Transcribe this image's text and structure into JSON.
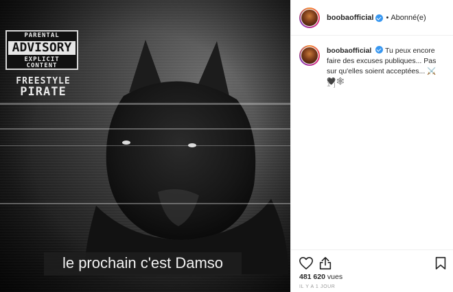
{
  "media": {
    "advisory": {
      "top": "PARENTAL",
      "mid": "ADVISORY",
      "bottom": "EXPLICIT CONTENT"
    },
    "freestyle": {
      "line1": "FREESTYLE",
      "line2": "PIRATE"
    },
    "subtitle": "le prochain c'est Damso"
  },
  "header": {
    "username": "boobaofficial",
    "separator": "•",
    "follow_status": "Abonné(e)"
  },
  "comment": {
    "username": "boobaofficial",
    "text": "Tu peux encore faire des excuses publiques... Pas sur qu'elles soient acceptées... ⚔️🖤🕸",
    "time": "1 j"
  },
  "footer": {
    "views_count": "481 620",
    "views_label": "vues",
    "posted": "IL Y A 1 JOUR"
  },
  "icons": [
    "heart-icon",
    "share-icon",
    "bookmark-icon",
    "verified-icon"
  ],
  "colors": {
    "verified": "#3897f0",
    "text": "#262626",
    "muted": "#999999",
    "border": "#efefef"
  }
}
